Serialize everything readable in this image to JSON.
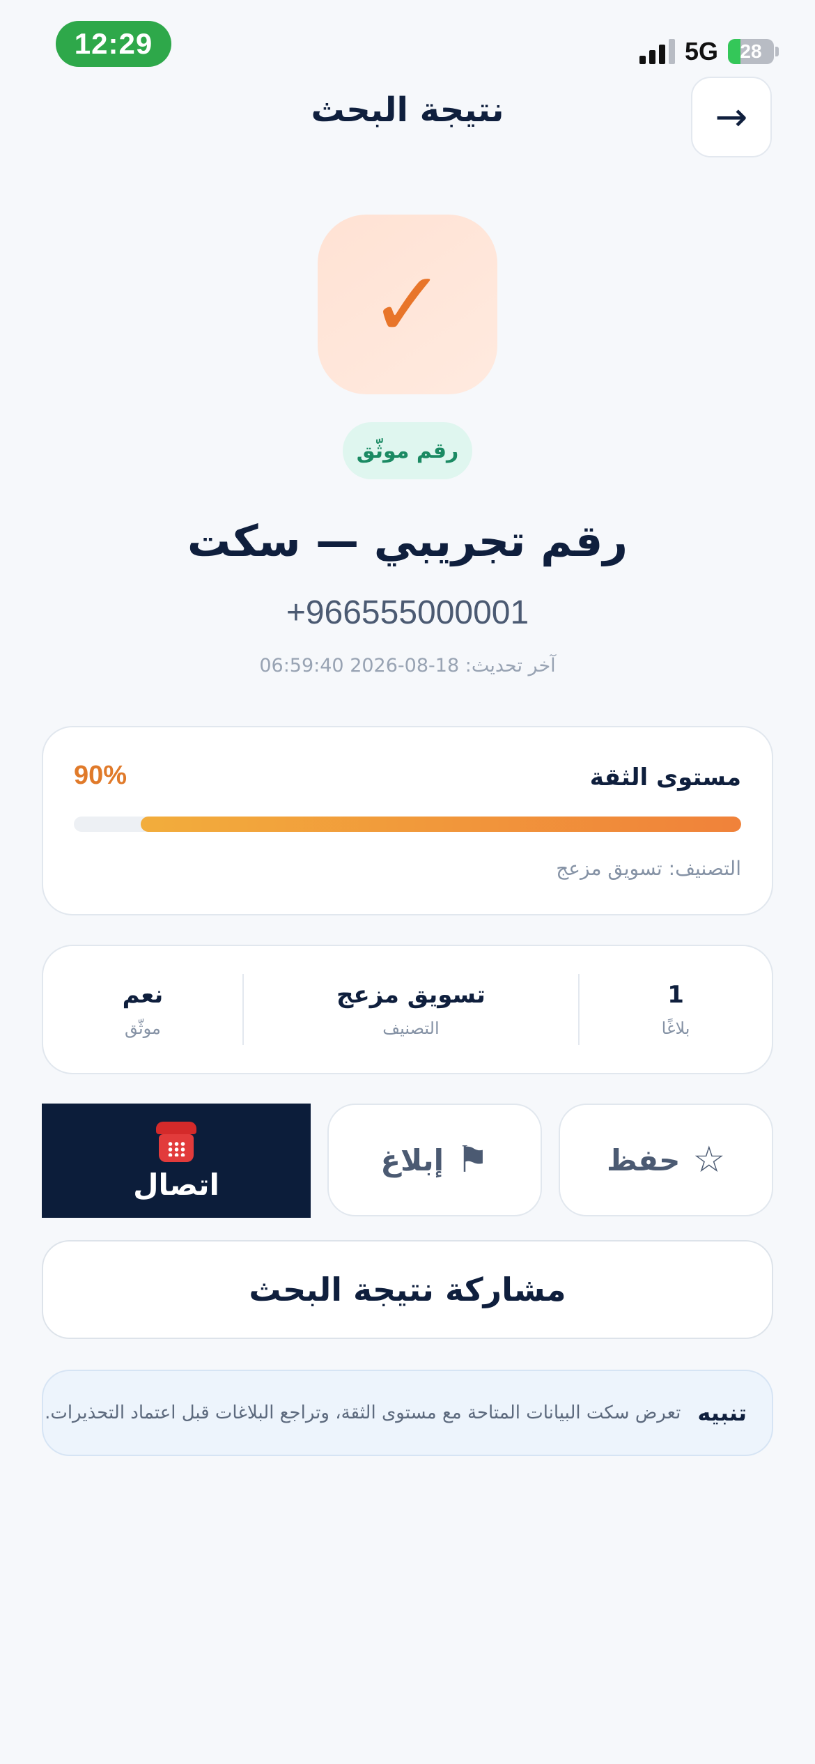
{
  "status_bar": {
    "time": "12:29",
    "network": "5G",
    "battery_percent": 28,
    "battery_label": "28",
    "signal_bars_active": 3
  },
  "header": {
    "title": "نتيجة البحث",
    "back_icon": "arrow-right-icon",
    "back_glyph": "→"
  },
  "result": {
    "status_icon": "checkmark-icon",
    "status_glyph": "✓",
    "badge": "رقم موثّق",
    "name": "رقم تجريبي — سكت",
    "phone": "+966555000001",
    "updated": "آخر تحديث: 18-08-2026 06:59:40"
  },
  "trust": {
    "label": "مستوى الثقة",
    "percent_label": "90%",
    "value": 0.9,
    "category": "التصنيف: تسويق مزعج"
  },
  "stats": [
    {
      "value": "1",
      "label": "بلاغًا"
    },
    {
      "value": "تسويق مزعج",
      "label": "التصنيف"
    },
    {
      "value": "نعم",
      "label": "موثّق"
    }
  ],
  "actions": {
    "save": {
      "label": "حفظ",
      "icon": "star-icon",
      "glyph": "☆"
    },
    "report": {
      "label": "إبلاغ",
      "icon": "flag-icon",
      "glyph": "⚑"
    },
    "call": {
      "label": "اتصال",
      "icon": "telephone-icon"
    },
    "share": {
      "label": "مشاركة نتيجة البحث"
    }
  },
  "notice": {
    "title": "تنبيه",
    "text": "تعرض سكت البيانات المتاحة مع مستوى الثقة، وتراجع البلاغات قبل اعتماد التحذيرات."
  },
  "colors": {
    "background": "#f6f8fb",
    "primary_dark": "#0c1d3a",
    "accent_orange": "#e07a2a",
    "verified_green": "#1b8a63",
    "status_green": "#2ea84a"
  }
}
